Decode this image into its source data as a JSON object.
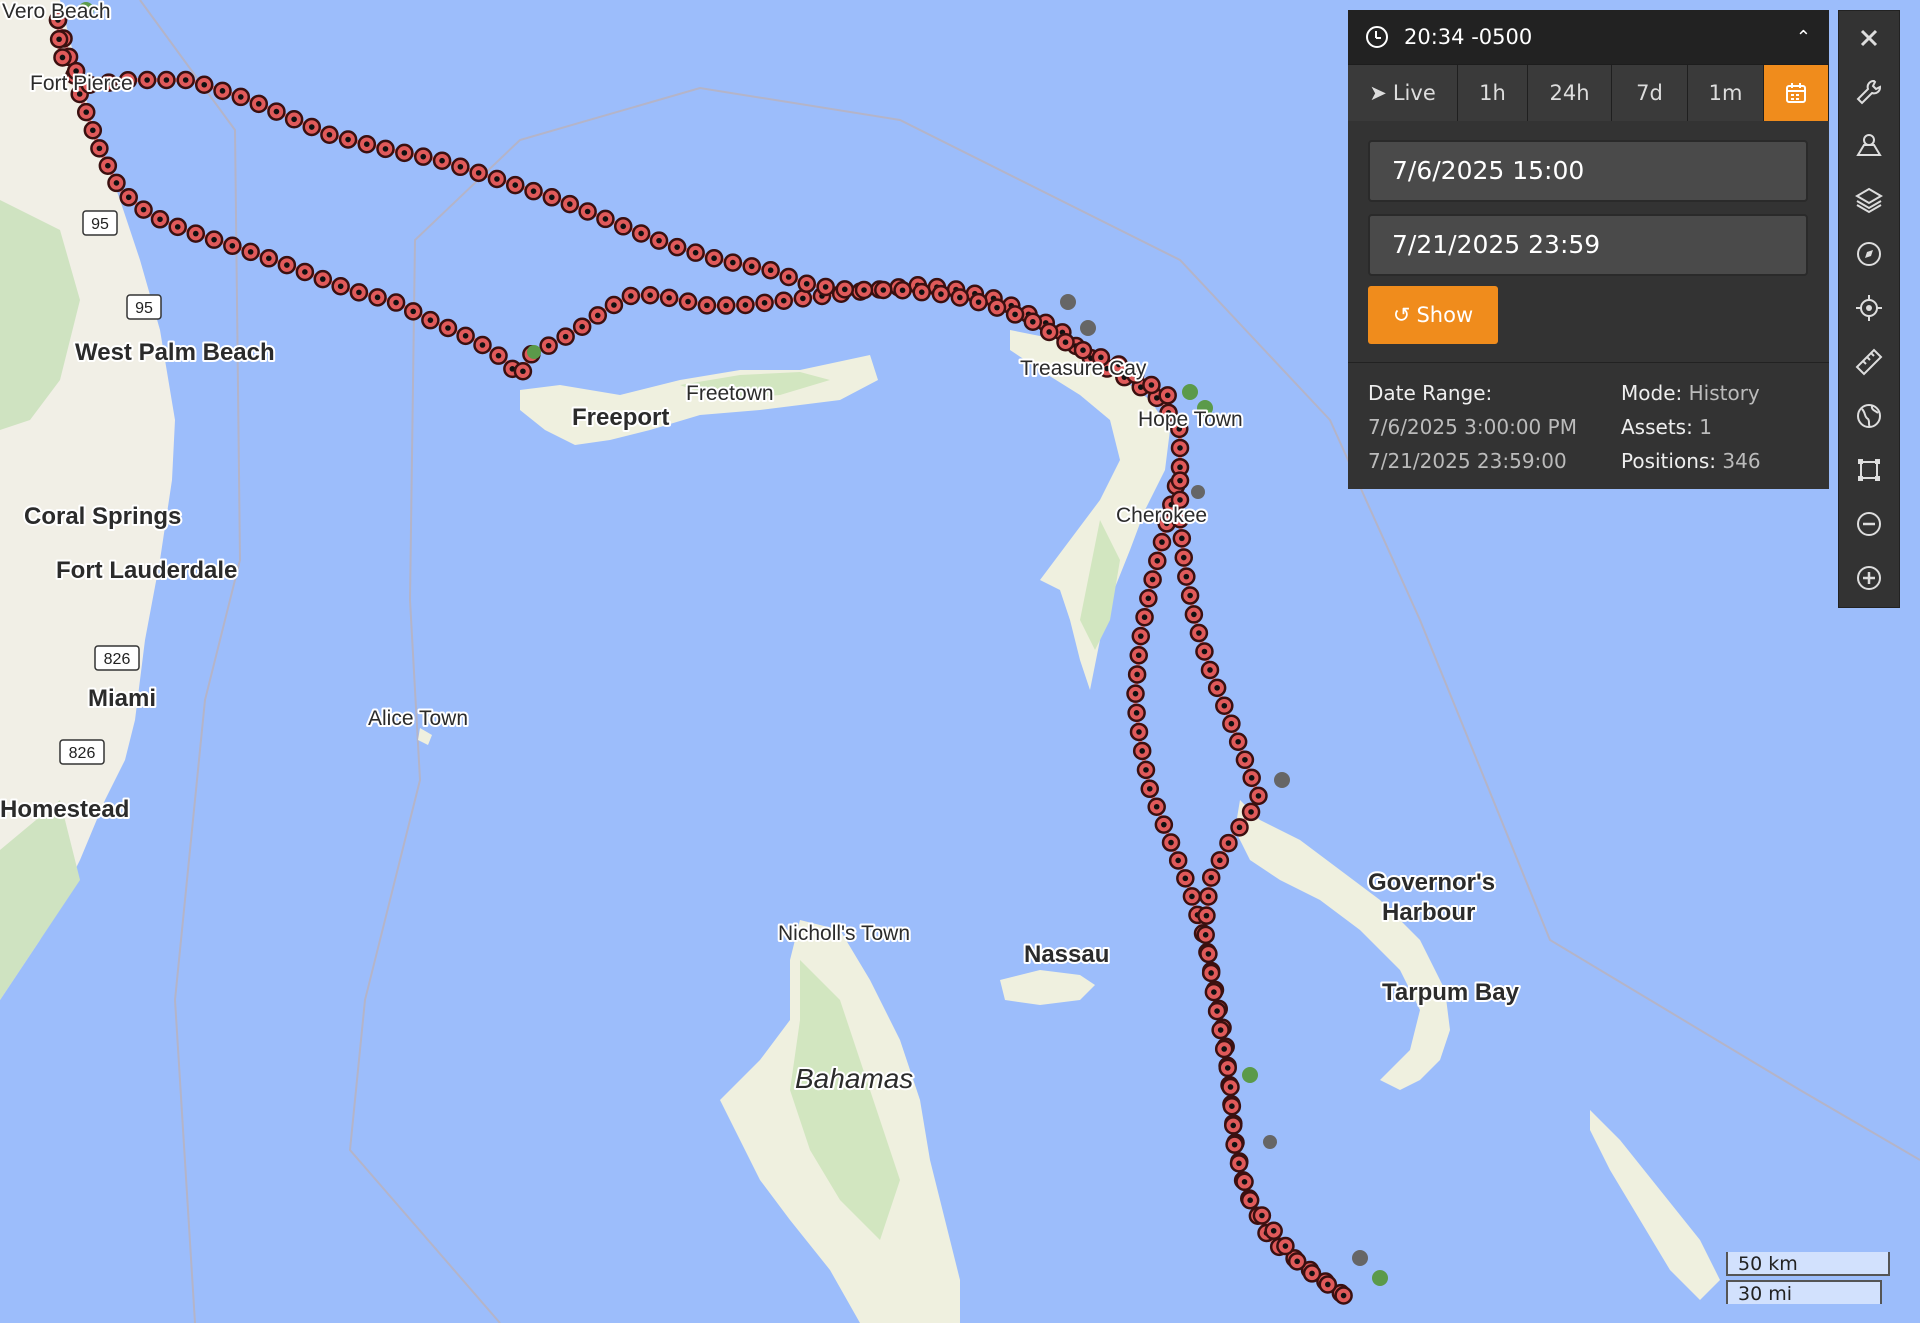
{
  "header": {
    "time": "20:34 -0500"
  },
  "tabs": [
    {
      "label": "Live",
      "icon": "navigation-arrow-icon"
    },
    {
      "label": "1h"
    },
    {
      "label": "24h"
    },
    {
      "label": "7d"
    },
    {
      "label": "1m"
    },
    {
      "label": "",
      "icon": "calendar-icon",
      "active": true
    }
  ],
  "range": {
    "start_input": "7/6/2025 15:00",
    "end_input": "7/21/2025 23:59",
    "show_label": "Show"
  },
  "info": {
    "date_range_label": "Date Range:",
    "date_start": "7/6/2025 3:00:00 PM",
    "date_end": "7/21/2025 23:59:00",
    "mode_label": "Mode:",
    "mode_value": "History",
    "assets_label": "Assets:",
    "assets_value": "1",
    "positions_label": "Positions:",
    "positions_value": "346"
  },
  "toolbar": [
    "close-icon",
    "wrench-icon",
    "map-pin-area-icon",
    "layers-icon",
    "compass-icon",
    "locate-icon",
    "ruler-icon",
    "globe-icon",
    "polygon-select-icon",
    "zoom-out-icon",
    "zoom-in-icon"
  ],
  "map": {
    "places": [
      {
        "name": "Vero Beach"
      },
      {
        "name": "Fort Pierce"
      },
      {
        "name": "West Palm Beach"
      },
      {
        "name": "Coral Springs"
      },
      {
        "name": "Fort Lauderdale"
      },
      {
        "name": "Miami"
      },
      {
        "name": "Homestead"
      },
      {
        "name": "Alice Town"
      },
      {
        "name": "Freeport"
      },
      {
        "name": "Freetown"
      },
      {
        "name": "Treasure Cay"
      },
      {
        "name": "Hope Town"
      },
      {
        "name": "Cherokee"
      },
      {
        "name": "Governor's"
      },
      {
        "name": "Harbour"
      },
      {
        "name": "Tarpum Bay"
      },
      {
        "name": "Nicholl's Town"
      },
      {
        "name": "Nassau"
      },
      {
        "name": "Bahamas"
      }
    ],
    "shields": [
      "95",
      "95",
      "826",
      "826"
    ],
    "scale": {
      "km": "50 km",
      "mi": "30 mi"
    },
    "track_color": "#e8848a",
    "marker_color": "#e05a5a"
  }
}
